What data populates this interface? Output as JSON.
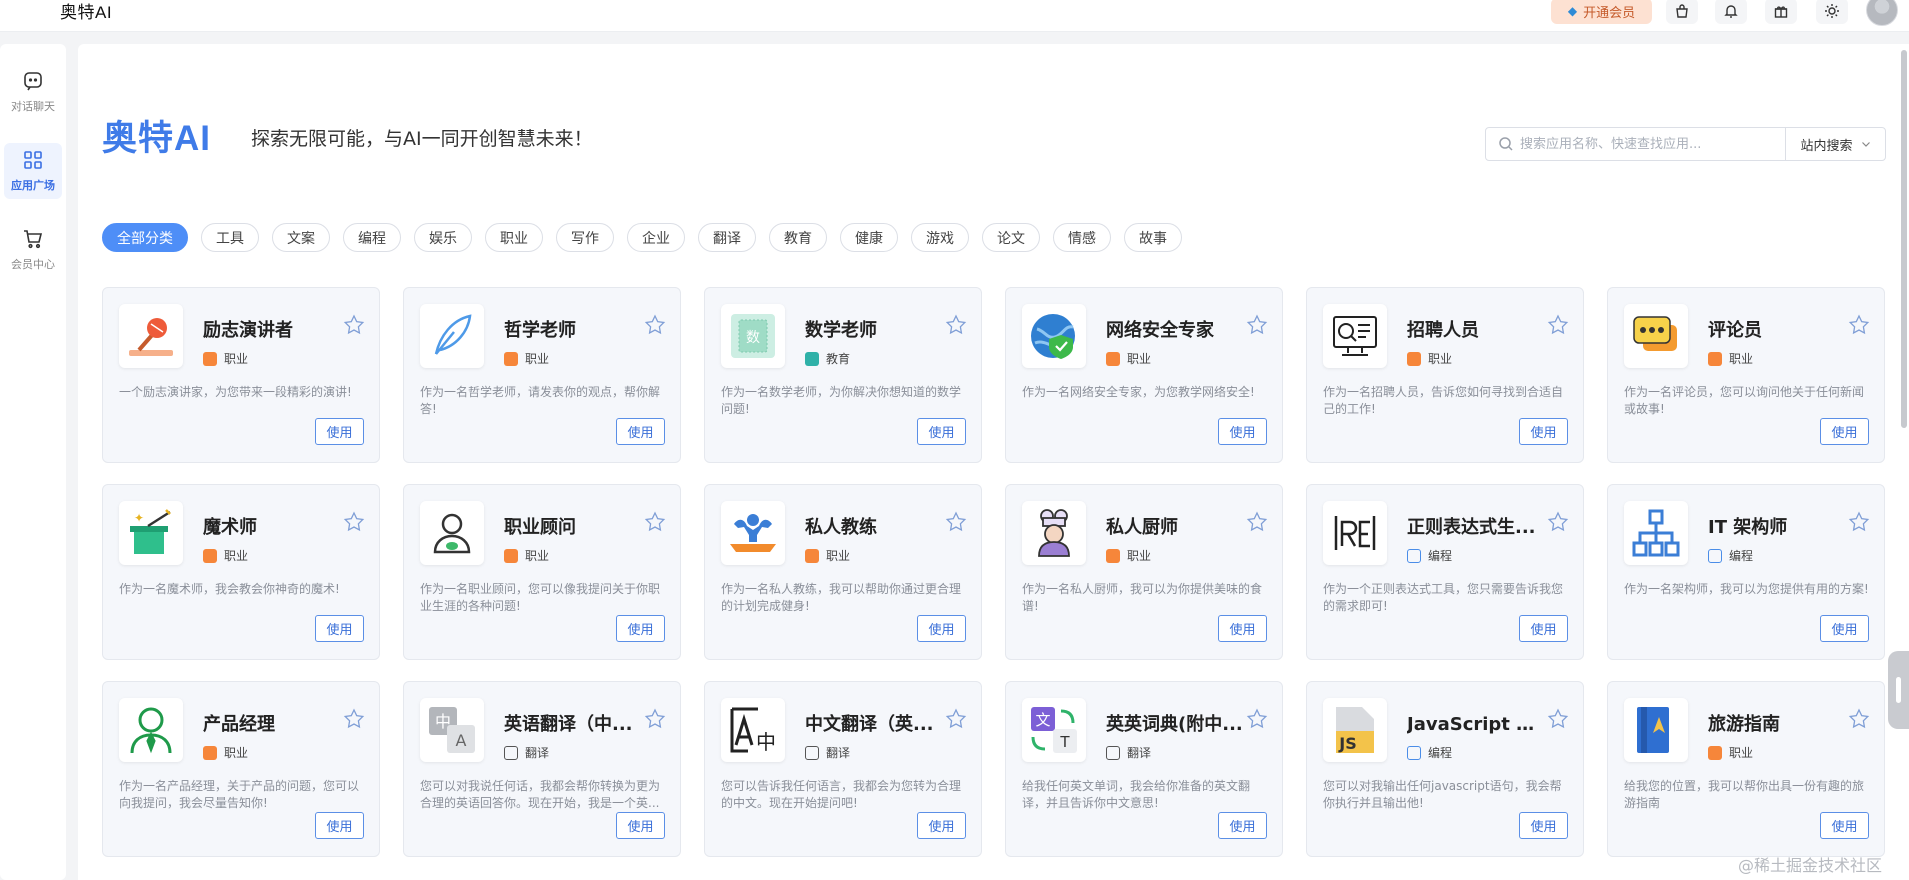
{
  "header": {
    "brand": "奥特AI",
    "vip_label": "开通会员",
    "icons": [
      "bag-icon",
      "bell-icon",
      "gift-icon",
      "sun-icon",
      "avatar"
    ]
  },
  "sidenav": {
    "items": [
      {
        "label": "对话聊天",
        "icon": "chat-icon",
        "active": false
      },
      {
        "label": "应用广场",
        "icon": "grid-icon",
        "active": true
      },
      {
        "label": "会员中心",
        "icon": "cart-icon",
        "active": false
      }
    ]
  },
  "hero": {
    "title": "奥特AI",
    "subtitle": "探索无限可能，与AI一同开创智慧未来！"
  },
  "search": {
    "placeholder": "搜索应用名称、快速查找应用...",
    "value": "",
    "scope": "站内搜索"
  },
  "categories": [
    "全部分类",
    "工具",
    "文案",
    "编程",
    "娱乐",
    "职业",
    "写作",
    "企业",
    "翻译",
    "教育",
    "健康",
    "游戏",
    "论文",
    "情感",
    "故事"
  ],
  "use_label": "使用",
  "cards": [
    {
      "name": "励志演讲者",
      "tag": "职业",
      "desc": "一个励志演讲家，为您带来一段精彩的演讲!"
    },
    {
      "name": "哲学老师",
      "tag": "职业",
      "desc": "作为一名哲学老师，请发表你的观点，帮你解答!"
    },
    {
      "name": "数学老师",
      "tag": "教育",
      "desc": "作为一名数学老师，为你解决你想知道的数学问题!"
    },
    {
      "name": "网络安全专家",
      "tag": "职业",
      "desc": "作为一名网络安全专家，为您教学网络安全!"
    },
    {
      "name": "招聘人员",
      "tag": "职业",
      "desc": "作为一名招聘人员，告诉您如何寻找到合适自己的工作!"
    },
    {
      "name": "评论员",
      "tag": "职业",
      "desc": "作为一名评论员，您可以询问他关于任何新闻或故事!"
    },
    {
      "name": "魔术师",
      "tag": "职业",
      "desc": "作为一名魔术师，我会教会你神奇的魔术!"
    },
    {
      "name": "职业顾问",
      "tag": "职业",
      "desc": "作为一名职业顾问，您可以像我提问关于你职业生涯的各种问题!"
    },
    {
      "name": "私人教练",
      "tag": "职业",
      "desc": "作为一名私人教练，我可以帮助你通过更合理的计划完成健身!"
    },
    {
      "name": "私人厨师",
      "tag": "职业",
      "desc": "作为一名私人厨师，我可以为你提供美味的食谱!"
    },
    {
      "name": "正则表达式生...",
      "tag": "编程",
      "desc": "作为一个正则表达式工具，您只需要告诉我您的需求即可!"
    },
    {
      "name": "IT 架构师",
      "tag": "编程",
      "desc": "作为一名架构师，我可以为您提供有用的方案!"
    },
    {
      "name": "产品经理",
      "tag": "职业",
      "desc": "作为一名产品经理，关于产品的问题，您可以向我提问，我会尽量告知你!"
    },
    {
      "name": "英语翻译（中...",
      "tag": "翻译",
      "desc": "您可以对我说任何话，我都会帮你转换为更为合理的英语回答你。现在开始，我是一个英..."
    },
    {
      "name": "中文翻译（英...",
      "tag": "翻译",
      "desc": "您可以告诉我任何语言，我都会为您转为合理的中文。现在开始提问吧!"
    },
    {
      "name": "英英词典(附中...",
      "tag": "翻译",
      "desc": "给我任何英文单词，我会给你准备的英文翻译，并且告诉你中文意思!"
    },
    {
      "name": "JavaScript 控...",
      "tag": "编程",
      "desc": "您可以对我输出任何javascript语句，我会帮你执行并且输出他!"
    },
    {
      "name": "旅游指南",
      "tag": "职业",
      "desc": "给我您的位置，我可以帮你出具一份有趣的旅游指南"
    }
  ],
  "watermark": "@稀土掘金技术社区"
}
